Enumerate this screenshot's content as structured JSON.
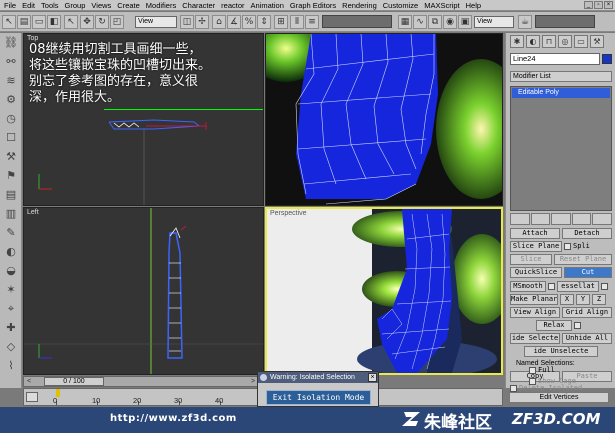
{
  "menu": [
    "File",
    "Edit",
    "Tools",
    "Group",
    "Views",
    "Create",
    "Modifiers",
    "Character",
    "reactor",
    "Animation",
    "Graph Editors",
    "Rendering",
    "Customize",
    "MAXScript",
    "Help"
  ],
  "toolbar": {
    "view_select": "View",
    "view_select2": "View"
  },
  "viewports": {
    "top_label": "Top",
    "left_label": "Left",
    "persp_label": "Perspective"
  },
  "overlay": {
    "text": "08继续用切割工具画细一些，\n将这些镶嵌宝珠的凹槽切出来。\n别忘了参考图的存在，意义很\n深，作用很大。"
  },
  "command_panel": {
    "object_name": "Line24",
    "modifier_list": "Modifier List",
    "stack_item": "Editable Poly",
    "partial_top_left": "Attach",
    "partial_top_right": "Detach",
    "slice_plane": "Slice Plane",
    "split": "Spli",
    "slice": "Slice",
    "reset_plane": "Reset Plane",
    "quickslice": "QuickSlice",
    "cut": "Cut",
    "msmooth": "MSmooth",
    "tessellate": "essellat",
    "make_planar": "Make Planar",
    "x": "X",
    "y": "Y",
    "z": "Z",
    "view_align": "View Align",
    "grid_align": "Grid Align",
    "relax": "Relax",
    "hide_selected": "ide Selecte",
    "unhide_all": "Unhide All",
    "hide_unselected": "ide Unselecte",
    "named_selections": "Named Selections:",
    "copy": "Copy",
    "paste": "Paste",
    "delete_isolated": "Delete Isolated",
    "full": "Full",
    "show_cage": "Show Cage",
    "edit_vertices": "Edit Vertices"
  },
  "timeslider": {
    "label": "0 / 100"
  },
  "trackbar": {
    "ticks": [
      "0",
      "10",
      "20",
      "30",
      "40"
    ]
  },
  "dialog": {
    "title": "Warning: Isolated Selection",
    "button": "Exit Isolation Mode"
  },
  "footer": {
    "url": "http://www.zf3d.com",
    "brand_cn": "朱峰社区",
    "brand_en": "ZF3D.COM"
  }
}
